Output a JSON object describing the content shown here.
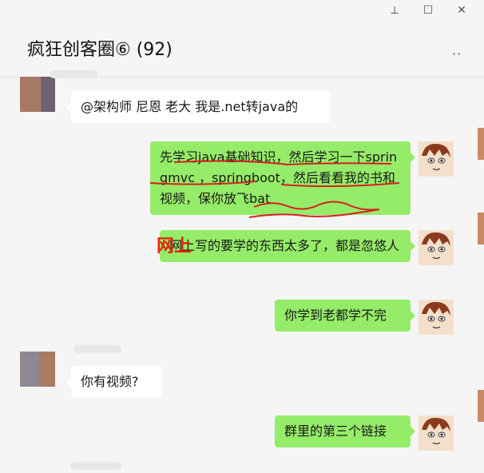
{
  "window": {
    "controls": {
      "pin": "⟂",
      "minimize": "—",
      "maximize": "☐",
      "close": "✕"
    }
  },
  "chat": {
    "title": "疯狂创客圈⑥ (92)",
    "more_label": "··"
  },
  "messages": [
    {
      "side": "left",
      "text": "@架构师 尼恩 老大 我是.net转java的"
    },
    {
      "side": "right",
      "text": "先学习java基础知识，然后学习一下springmvc ，springboot，然后看看我的书和视频，保你放飞bat"
    },
    {
      "side": "right",
      "text": "网上写的要学的东西太多了，都是忽悠人"
    },
    {
      "side": "right",
      "text": "你学到老都学不完"
    },
    {
      "side": "left",
      "text": "你有视频?"
    },
    {
      "side": "right",
      "text": "群里的第三个链接"
    }
  ],
  "annotation": {
    "text": "网上",
    "color": "#e8230f"
  },
  "colors": {
    "bubble_right": "#95ec69",
    "bubble_left": "#ffffff",
    "background": "#f5f5f5"
  }
}
